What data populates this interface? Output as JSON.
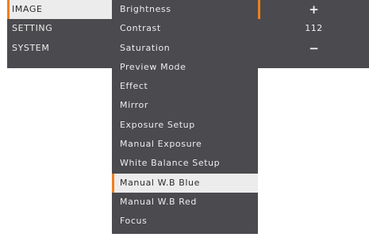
{
  "categories": [
    {
      "label": "IMAGE",
      "selected": true
    },
    {
      "label": "SETTING",
      "selected": false
    },
    {
      "label": "SYSTEM",
      "selected": false
    }
  ],
  "items": [
    {
      "label": "Brightness"
    },
    {
      "label": "Contrast"
    },
    {
      "label": "Saturation"
    },
    {
      "label": "Preview Mode"
    },
    {
      "label": "Effect"
    },
    {
      "label": "Mirror"
    },
    {
      "label": "Exposure Setup"
    },
    {
      "label": "Manual Exposure"
    },
    {
      "label": "White Balance Setup"
    },
    {
      "label": "Manual W.B Blue",
      "selected": true
    },
    {
      "label": "Manual W.B Red"
    },
    {
      "label": "Focus"
    }
  ],
  "adjust": {
    "increase_symbol": "+",
    "value": "112",
    "decrease_symbol": "−"
  },
  "colors": {
    "panel": "#4a4a4f",
    "selected_bg": "#ececec",
    "accent": "#f07f1e"
  }
}
